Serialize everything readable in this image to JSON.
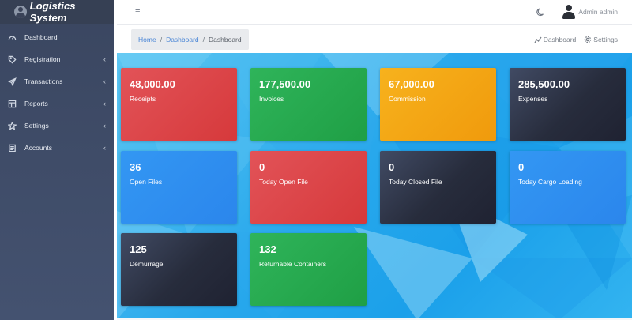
{
  "brand": {
    "name": "Logistics System"
  },
  "sidebar": {
    "items": [
      {
        "label": "Dashboard",
        "icon": "dashboard-gauge-icon",
        "has_submenu": false
      },
      {
        "label": "Registration",
        "icon": "tag-icon",
        "has_submenu": true
      },
      {
        "label": "Transactions",
        "icon": "paper-plane-icon",
        "has_submenu": true
      },
      {
        "label": "Reports",
        "icon": "table-icon",
        "has_submenu": true
      },
      {
        "label": "Settings",
        "icon": "star-icon",
        "has_submenu": true
      },
      {
        "label": "Accounts",
        "icon": "document-icon",
        "has_submenu": true
      }
    ],
    "chevron": "‹"
  },
  "topbar": {
    "menu_icon": "≡",
    "user_name": "Admin admin"
  },
  "breadcrumb": {
    "home": "Home",
    "sep": "/",
    "dashboard": "Dashboard",
    "current": "Dashboard"
  },
  "subheader_links": {
    "dashboard": "Dashboard",
    "settings": "Settings"
  },
  "cards": [
    {
      "value": "48,000.00",
      "label": "Receipts",
      "color": "#dd4548"
    },
    {
      "value": "177,500.00",
      "label": "Invoices",
      "color": "#28a84f"
    },
    {
      "value": "67,000.00",
      "label": "Commission",
      "color": "#f4a716"
    },
    {
      "value": "285,500.00",
      "label": "Expenses",
      "color": "#2c3244"
    },
    {
      "value": "36",
      "label": "Open Files",
      "color": "#2f8ff0"
    },
    {
      "value": "0",
      "label": "Today Open File",
      "color": "#dd4548"
    },
    {
      "value": "0",
      "label": "Today Closed File",
      "color": "#2c3244"
    },
    {
      "value": "0",
      "label": "Today Cargo Loading",
      "color": "#2f8ff0"
    },
    {
      "value": "125",
      "label": "Demurrage",
      "color": "#2c3244"
    },
    {
      "value": "132",
      "label": "Returnable Containers",
      "color": "#28a84f"
    }
  ]
}
